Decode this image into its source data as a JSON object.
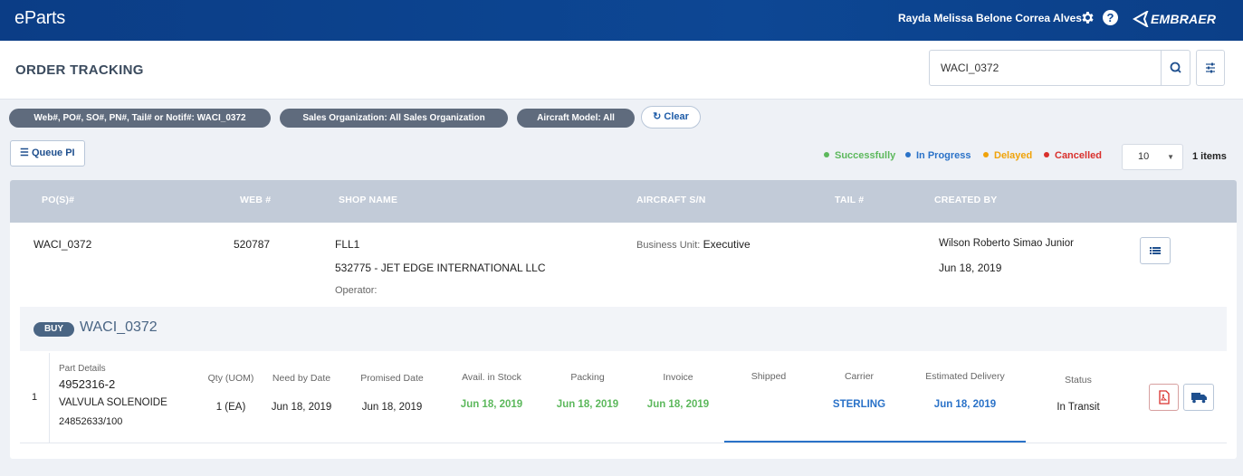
{
  "app": {
    "logo": "eParts",
    "user_name": "Rayda Melissa Belone Correa Alves",
    "brand": "EMBRAER"
  },
  "header": {
    "title": "ORDER TRACKING",
    "search_value": "WACI_0372"
  },
  "filters": [
    {
      "label": "Web#, PO#, SO#, PN#, Tail# or Notif#: WACI_0372"
    },
    {
      "label": "Sales Organization: All Sales Organization"
    },
    {
      "label": "Aircraft Model: All"
    }
  ],
  "clear_label": "Clear",
  "queue_label": "Queue PI",
  "legend": [
    {
      "label": "Successfully",
      "color": "#5cb85c"
    },
    {
      "label": "In Progress",
      "color": "#2a72c8"
    },
    {
      "label": "Delayed",
      "color": "#f0a30a"
    },
    {
      "label": "Cancelled",
      "color": "#d9302c"
    }
  ],
  "page_size": "10",
  "items_count": "1 items",
  "table": {
    "columns": [
      "PO(S)#",
      "WEB #",
      "SHOP NAME",
      "AIRCRAFT S/N",
      "TAIL #",
      "CREATED BY"
    ],
    "row": {
      "po": "WACI_0372",
      "web": "520787",
      "shop_name": "FLL1",
      "shop_customer": "532775 - JET EDGE INTERNATIONAL LLC",
      "operator_label": "Operator:",
      "business_unit_label": "Business Unit:",
      "business_unit": "Executive",
      "created_by": "Wilson Roberto Simao Junior",
      "created_date": "Jun 18, 2019"
    }
  },
  "order": {
    "badge": "BUY",
    "number": "WACI_0372",
    "item": {
      "index": "1",
      "part_details_label": "Part Details",
      "part_number": "4952316-2",
      "description": "VALVULA SOLENOIDE",
      "sub_number": "24852633/100",
      "qty_label": "Qty (UOM)",
      "qty": "1 (EA)",
      "need_by_label": "Need by Date",
      "need_by": "Jun 18, 2019",
      "promised_label": "Promised Date",
      "promised": "Jun 18, 2019",
      "stock_label": "Avail. in Stock",
      "stock": "Jun 18, 2019",
      "packing_label": "Packing",
      "packing": "Jun 18, 2019",
      "invoice_label": "Invoice",
      "invoice": "Jun 18, 2019",
      "shipped_label": "Shipped",
      "carrier_label": "Carrier",
      "carrier": "STERLING",
      "delivery_label": "Estimated Delivery",
      "delivery": "Jun 18, 2019",
      "status_label": "Status",
      "status": "In Transit"
    }
  }
}
